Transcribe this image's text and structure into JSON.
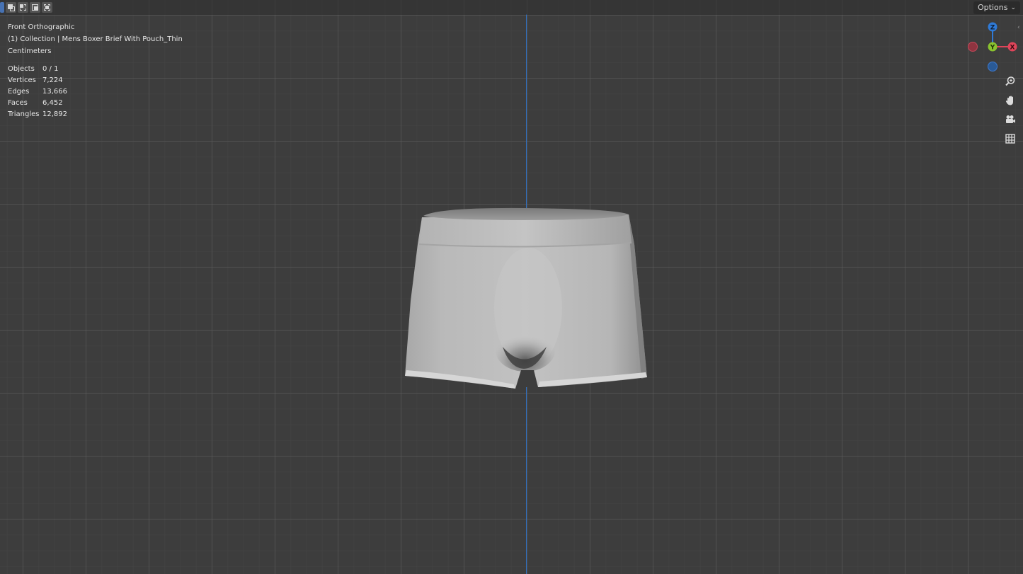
{
  "header": {
    "select_modes": [
      "set-new-selection",
      "extend-selection",
      "subtract-selection",
      "invert-selection",
      "intersect-selection"
    ],
    "options_label": "Options"
  },
  "overlay": {
    "view_name": "Front Orthographic",
    "collection_line": "(1) Collection | Mens Boxer Brief With Pouch_Thin",
    "units": "Centimeters",
    "stats": [
      {
        "label": "Objects",
        "value": "0 / 1"
      },
      {
        "label": "Vertices",
        "value": "7,224"
      },
      {
        "label": "Edges",
        "value": "13,666"
      },
      {
        "label": "Faces",
        "value": "6,452"
      },
      {
        "label": "Triangles",
        "value": "12,892"
      }
    ]
  },
  "gizmo": {
    "z_label": "Z",
    "y_label": "Y",
    "x_label": "X",
    "colors": {
      "x": "#e0455a",
      "y": "#8ac32f",
      "z": "#2f7ad6"
    }
  },
  "nav_tools": [
    "zoom-icon",
    "hand-pan-icon",
    "camera-icon",
    "grid-ortho-icon"
  ],
  "colors": {
    "viewport_bg": "#3d3d3d",
    "grid_major": "#5f5f5f",
    "axis_z": "#2f6fc0",
    "mesh": "#bdbdbd"
  }
}
